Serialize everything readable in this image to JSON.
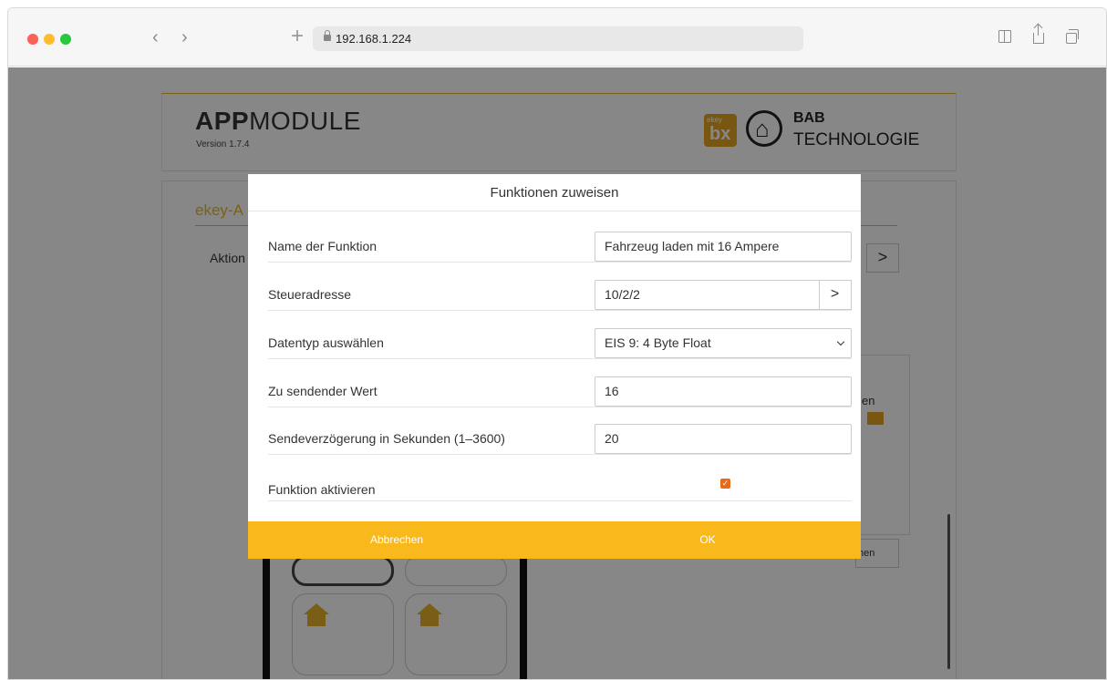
{
  "browser": {
    "url": "192.168.1.224",
    "back_icon": "‹",
    "forward_icon": "›",
    "new_tab_icon": "+"
  },
  "header": {
    "brand_bold": "APP",
    "brand_light": "MODULE",
    "version": "Version 1.7.4",
    "ekey_mark": "ekey",
    "ekey_glyph": "bx",
    "bab_name": "BAB",
    "bab_sub": "TECHNOLOGIE"
  },
  "background": {
    "card_title": "ekey-A",
    "action_label": "Aktion",
    "chevron": ">",
    "panel_text": "en",
    "button_text": "hen"
  },
  "modal": {
    "title": "Funktionen zuweisen",
    "fields": {
      "name_label": "Name der Funktion",
      "name_value": "Fahrzeug laden mit 16 Ampere",
      "address_label": "Steueradresse",
      "address_value": "10/2/2",
      "address_button": ">",
      "datatype_label": "Datentyp auswählen",
      "datatype_value": "EIS 9: 4 Byte Float",
      "value_label": "Zu sendender Wert",
      "value_value": "16",
      "delay_label": "Sendeverzögerung in Sekunden (1–3600)",
      "delay_value": "20",
      "activate_label": "Funktion aktivieren",
      "activate_checked": true
    },
    "cancel_label": "Abbrechen",
    "ok_label": "OK"
  },
  "colors": {
    "accent": "#f9b91d",
    "brand_gold": "#e7b72a",
    "checkbox": "#e86a17"
  }
}
